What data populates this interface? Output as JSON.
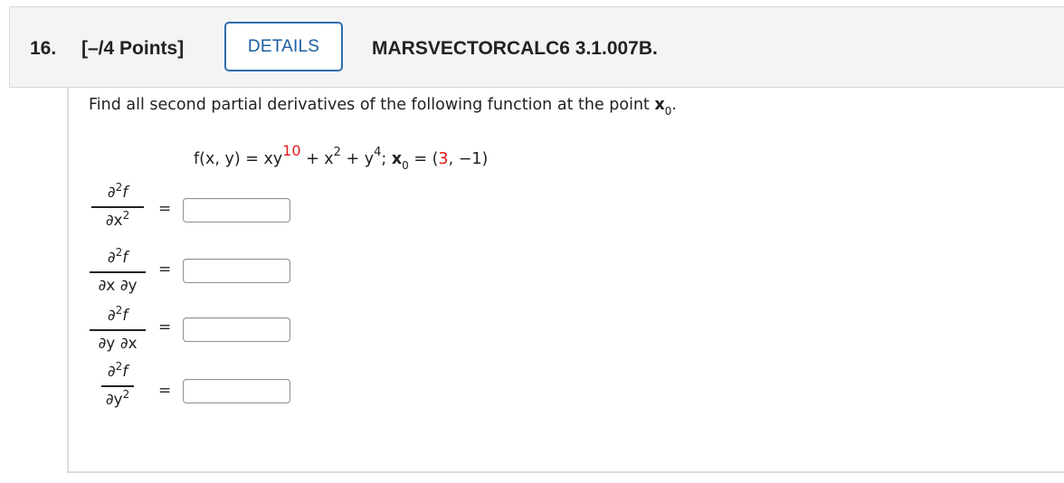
{
  "question": {
    "number": "16.",
    "points": "[–/4 Points]",
    "details_label": "DETAILS",
    "id": "MARSVECTORCALC6 3.1.007B."
  },
  "prompt": {
    "text": "Find all second partial derivatives of the following function at the point ",
    "point_symbol": "x",
    "point_sub": "0",
    "end": "."
  },
  "formula": {
    "lhs": "f(x, y) = xy",
    "exp1": "10",
    "part2": " + x",
    "exp2": "2",
    "part3": " + y",
    "exp3": "4",
    "part4": "; ",
    "point_symbol": "x",
    "point_sub": "0",
    "part5": " = (",
    "x0_first": "3",
    "part6": ", −1)"
  },
  "derivatives": [
    {
      "num_d": "∂",
      "num_exp": "2",
      "num_f": "f",
      "den": "∂x",
      "den_exp": "2",
      "equals": "=",
      "value": ""
    },
    {
      "num_d": "∂",
      "num_exp": "2",
      "num_f": "f",
      "den": "∂x ∂y",
      "den_exp": "",
      "equals": "=",
      "value": ""
    },
    {
      "num_d": "∂",
      "num_exp": "2",
      "num_f": "f",
      "den": "∂y ∂x",
      "den_exp": "",
      "equals": "=",
      "value": ""
    },
    {
      "num_d": "∂",
      "num_exp": "2",
      "num_f": "f",
      "den": "∂y",
      "den_exp": "2",
      "equals": "=",
      "value": ""
    }
  ],
  "colors": {
    "accent": "#2f6dac",
    "highlight": "#e21a1a",
    "header_bg": "#f4f4f4"
  }
}
